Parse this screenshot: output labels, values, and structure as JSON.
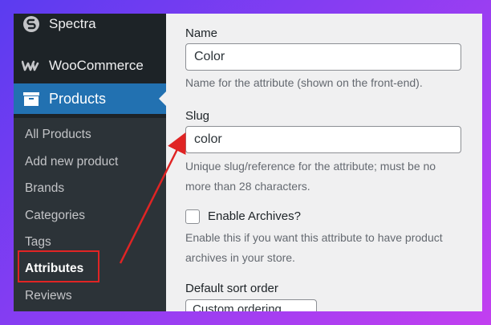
{
  "sidebar": {
    "spectra_label": "Spectra",
    "woocommerce_label": "WooCommerce",
    "products_label": "Products",
    "submenu": [
      {
        "label": "All Products"
      },
      {
        "label": "Add new product"
      },
      {
        "label": "Brands"
      },
      {
        "label": "Categories"
      },
      {
        "label": "Tags"
      },
      {
        "label": "Attributes"
      },
      {
        "label": "Reviews"
      }
    ],
    "active_item": "Attributes"
  },
  "form": {
    "name_label": "Name",
    "name_value": "Color",
    "name_description": "Name for the attribute (shown on the front-end).",
    "slug_label": "Slug",
    "slug_value": "color",
    "slug_description": "Unique slug/reference for the attribute; must be no more than 28 characters.",
    "archives_label": "Enable Archives?",
    "archives_checked": false,
    "archives_description": "Enable this if you want this attribute to have product archives in your store.",
    "sort_label": "Default sort order",
    "sort_value": "Custom ordering"
  },
  "colors": {
    "highlight": "#e02424",
    "menu_active": "#2271b1"
  }
}
